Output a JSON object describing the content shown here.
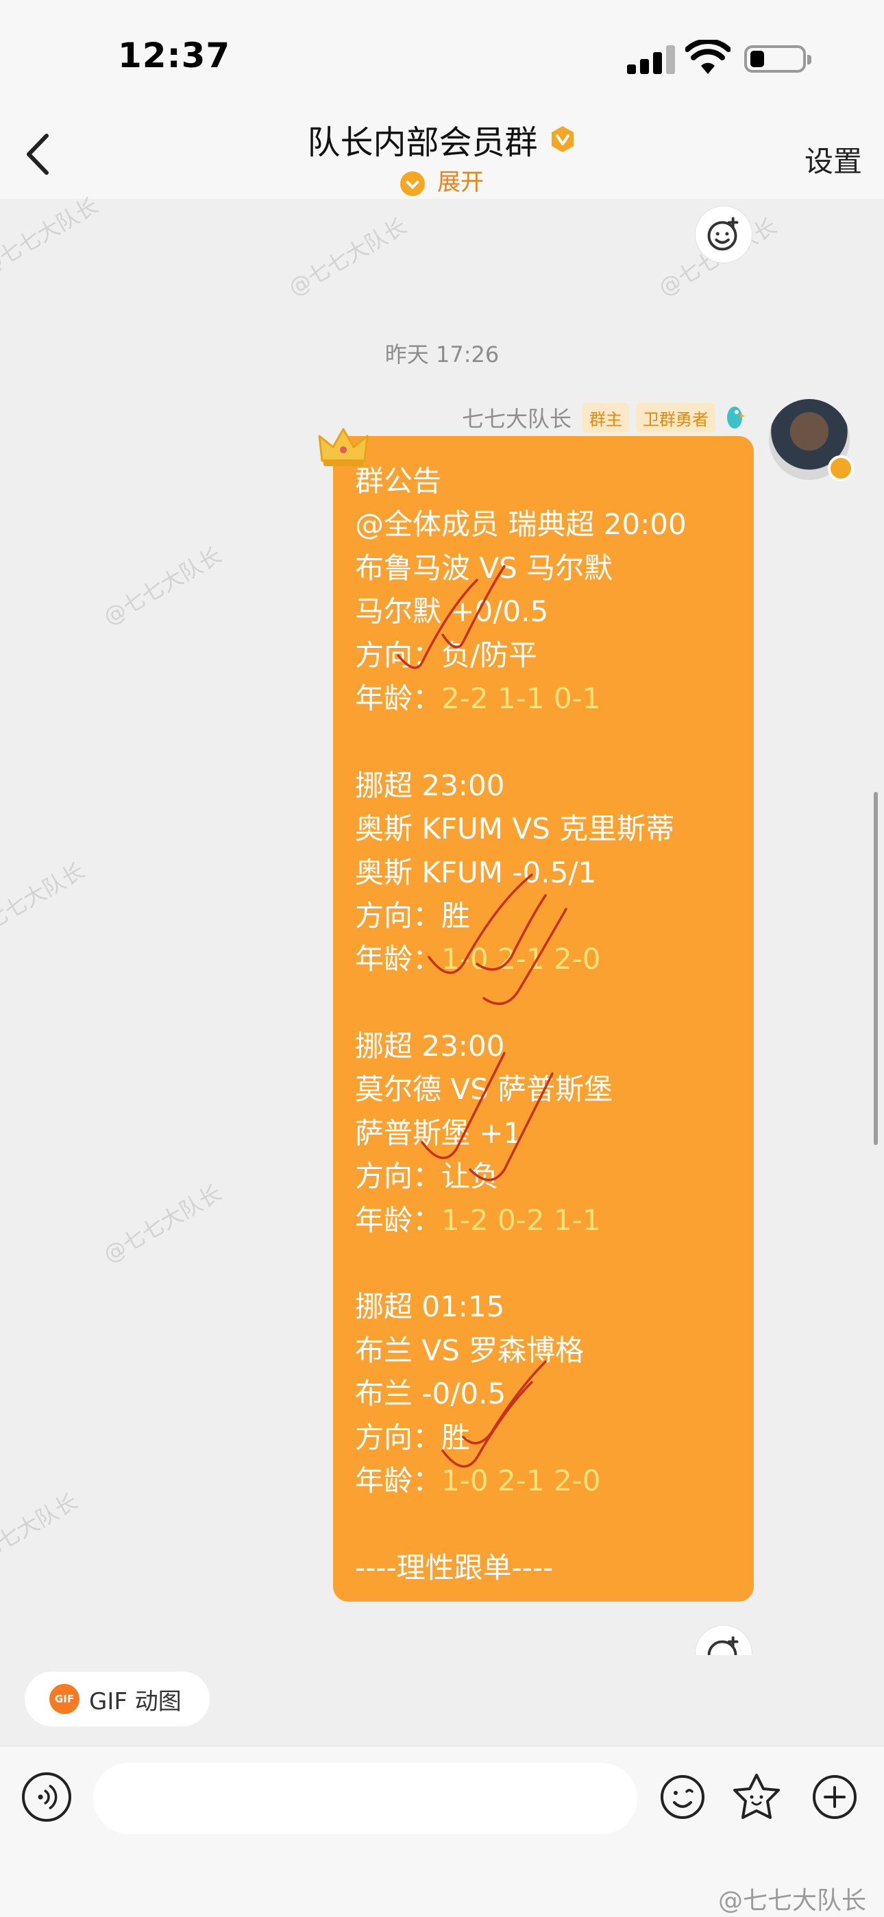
{
  "status_bar": {
    "time": "12:37"
  },
  "header": {
    "title": "队长内部会员群",
    "expand_label": "展开",
    "settings_label": "设置"
  },
  "watermark_text": "@七七大队长",
  "conversation": {
    "timestamp": "昨天 17:26",
    "sender": {
      "name": "七七大队长",
      "tags": [
        "群主",
        "卫群勇者"
      ]
    },
    "message_lines": [
      {
        "text": "群公告"
      },
      {
        "text": "@全体成员 瑞典超 20:00"
      },
      {
        "text": "布鲁马波 VS 马尔默"
      },
      {
        "text": "马尔默 +0/0.5"
      },
      {
        "text": "方向：负/防平"
      },
      {
        "label": "年龄：",
        "value": "2-2 1-1 0-1"
      },
      {
        "text": ""
      },
      {
        "text": "挪超 23:00"
      },
      {
        "text": "奥斯 KFUM VS 克里斯蒂"
      },
      {
        "text": "奥斯 KFUM -0.5/1"
      },
      {
        "text": "方向：胜"
      },
      {
        "label": "年龄：",
        "value": "1-0 2-1 2-0"
      },
      {
        "text": ""
      },
      {
        "text": "挪超 23:00"
      },
      {
        "text": "莫尔德 VS 萨普斯堡"
      },
      {
        "text": "萨普斯堡 +1"
      },
      {
        "text": "方向：让负"
      },
      {
        "label": "年龄：",
        "value": "1-2 0-2 1-1"
      },
      {
        "text": ""
      },
      {
        "text": "挪超 01:15"
      },
      {
        "text": "布兰 VS 罗森博格"
      },
      {
        "text": "布兰 -0/0.5"
      },
      {
        "text": "方向：胜"
      },
      {
        "label": "年龄：",
        "value": "1-0 2-1 2-0"
      },
      {
        "text": ""
      },
      {
        "text": "----理性跟单----"
      }
    ]
  },
  "gif_button": {
    "icon_text": "GIF",
    "label": "GIF 动图"
  },
  "input": {
    "value": "",
    "placeholder": ""
  },
  "colors": {
    "bubble": "#fba131",
    "accent": "#f5a623",
    "highlight_text": "#ffe27a",
    "check_marks": "#c8311b"
  }
}
